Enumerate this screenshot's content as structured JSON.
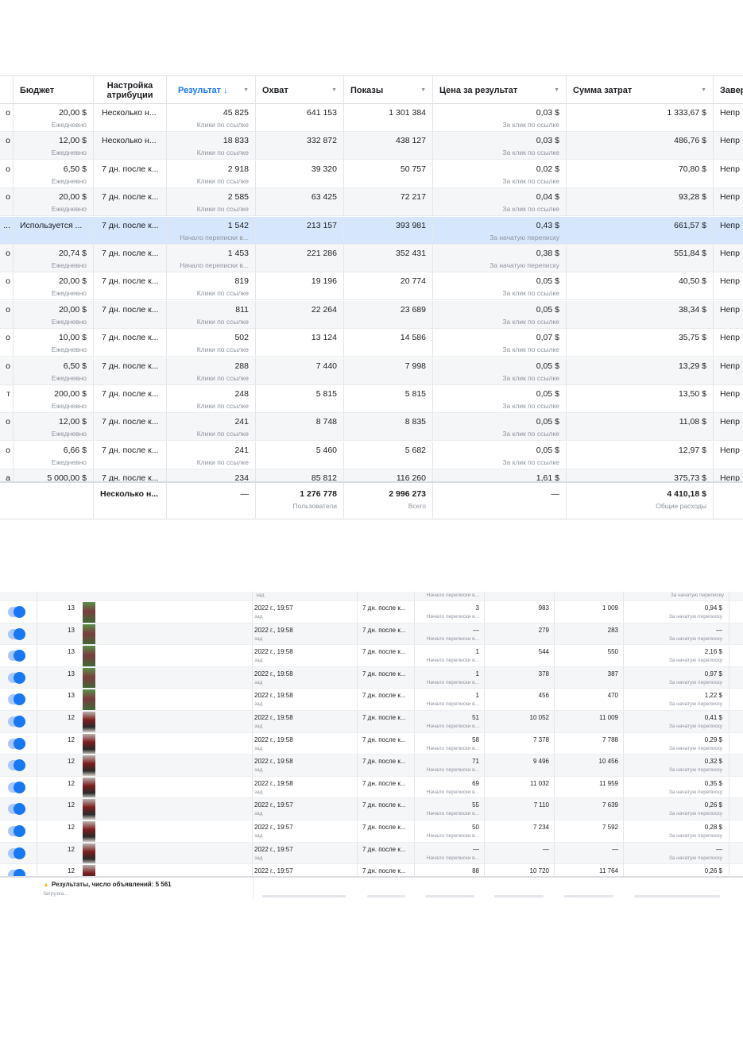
{
  "top_table": {
    "headers": [
      {
        "label": "Бюджет"
      },
      {
        "label": "Настройка атрибуции"
      },
      {
        "label": "Результат ↓"
      },
      {
        "label": "Охват"
      },
      {
        "label": "Показы"
      },
      {
        "label": "Цена за результат"
      },
      {
        "label": "Сумма затрат"
      },
      {
        "label": "Завер"
      }
    ],
    "rows": [
      {
        "c0": "о",
        "budget": "20,00 $",
        "budget_sub": "Ежедневно",
        "attribution": "Несколько н...",
        "result": "45 825",
        "result_sub": "Клики по ссылке",
        "reach": "641 153",
        "impressions": "1 301 384",
        "cpr": "0,03 $",
        "cpr_sub": "За клик по ссылке",
        "spend": "1 333,67 $",
        "end": "Непр"
      },
      {
        "c0": "о",
        "budget": "12,00 $",
        "budget_sub": "Ежедневно",
        "attribution": "Несколько н...",
        "result": "18 833",
        "result_sub": "Клики по ссылке",
        "reach": "332 872",
        "impressions": "438 127",
        "cpr": "0,03 $",
        "cpr_sub": "За клик по ссылке",
        "spend": "486,76 $",
        "end": "Непр"
      },
      {
        "c0": "о",
        "budget": "6,50 $",
        "budget_sub": "Ежедневно",
        "attribution": "7 дн. после к...",
        "result": "2 918",
        "result_sub": "Клики по ссылке",
        "reach": "39 320",
        "impressions": "50 757",
        "cpr": "0,02 $",
        "cpr_sub": "За клик по ссылке",
        "spend": "70,80 $",
        "end": "Непр"
      },
      {
        "c0": "о",
        "budget": "20,00 $",
        "budget_sub": "Ежедневно",
        "attribution": "7 дн. после к...",
        "result": "2 585",
        "result_sub": "Клики по ссылке",
        "reach": "63 425",
        "impressions": "72 217",
        "cpr": "0,04 $",
        "cpr_sub": "За клик по ссылке",
        "spend": "93,28 $",
        "end": "Непр"
      },
      {
        "c0": "...",
        "budget_left": "Используется ...",
        "budget": "",
        "budget_sub": "",
        "attribution": "7 дн. после к...",
        "result": "1 542",
        "result_sub": "Начало переписки в...",
        "reach": "213 157",
        "impressions": "393 981",
        "cpr": "0,43 $",
        "cpr_sub": "За начатую переписку",
        "spend": "661,57 $",
        "end": "Непр"
      },
      {
        "c0": "о",
        "budget": "20,74 $",
        "budget_sub": "Ежедневно",
        "attribution": "7 дн. после к...",
        "result": "1 453",
        "result_sub": "Начало переписки в...",
        "reach": "221 286",
        "impressions": "352 431",
        "cpr": "0,38 $",
        "cpr_sub": "За начатую переписку",
        "spend": "551,84 $",
        "end": "Непр"
      },
      {
        "c0": "о",
        "budget": "20,00 $",
        "budget_sub": "Ежедневно",
        "attribution": "7 дн. после к...",
        "result": "819",
        "result_sub": "Клики по ссылке",
        "reach": "19 196",
        "impressions": "20 774",
        "cpr": "0,05 $",
        "cpr_sub": "За клик по ссылке",
        "spend": "40,50 $",
        "end": "Непр"
      },
      {
        "c0": "о",
        "budget": "20,00 $",
        "budget_sub": "Ежедневно",
        "attribution": "7 дн. после к...",
        "result": "811",
        "result_sub": "Клики по ссылке",
        "reach": "22 264",
        "impressions": "23 689",
        "cpr": "0,05 $",
        "cpr_sub": "За клик по ссылке",
        "spend": "38,34 $",
        "end": "Непр"
      },
      {
        "c0": "о",
        "budget": "10,00 $",
        "budget_sub": "Ежедневно",
        "attribution": "7 дн. после к...",
        "result": "502",
        "result_sub": "Клики по ссылке",
        "reach": "13 124",
        "impressions": "14 586",
        "cpr": "0,07 $",
        "cpr_sub": "За клик по ссылке",
        "spend": "35,75 $",
        "end": "Непр"
      },
      {
        "c0": "о",
        "budget": "6,50 $",
        "budget_sub": "Ежедневно",
        "attribution": "7 дн. после к...",
        "result": "288",
        "result_sub": "Клики по ссылке",
        "reach": "7 440",
        "impressions": "7 998",
        "cpr": "0,05 $",
        "cpr_sub": "За клик по ссылке",
        "spend": "13,29 $",
        "end": "Непр"
      },
      {
        "c0": "т",
        "budget": "200,00 $",
        "budget_sub": "Ежедневно",
        "attribution": "7 дн. после к...",
        "result": "248",
        "result_sub": "Клики по ссылке",
        "reach": "5 815",
        "impressions": "5 815",
        "cpr": "0,05 $",
        "cpr_sub": "За клик по ссылке",
        "spend": "13,50 $",
        "end": "Непр"
      },
      {
        "c0": "о",
        "budget": "12,00 $",
        "budget_sub": "Ежедневно",
        "attribution": "7 дн. после к...",
        "result": "241",
        "result_sub": "Клики по ссылке",
        "reach": "8 748",
        "impressions": "8 835",
        "cpr": "0,05 $",
        "cpr_sub": "За клик по ссылке",
        "spend": "11,08 $",
        "end": "Непр"
      },
      {
        "c0": "о",
        "budget": "6,66 $",
        "budget_sub": "Ежедневно",
        "attribution": "7 дн. после к...",
        "result": "241",
        "result_sub": "Клики по ссылке",
        "reach": "5 460",
        "impressions": "5 682",
        "cpr": "0,05 $",
        "cpr_sub": "За клик по ссылке",
        "spend": "12,97 $",
        "end": "Непр"
      },
      {
        "c0": "а",
        "budget": "5 000,00 $",
        "budget_sub": "",
        "attribution": "7 дн. после к...",
        "result": "234",
        "result_sub": "",
        "reach": "85 812",
        "impressions": "116 260",
        "cpr": "1,61 $",
        "cpr_sub": "",
        "spend": "375,73 $",
        "end": "Непр"
      }
    ],
    "totals": {
      "attribution": "Несколько н...",
      "result": "—",
      "reach": "1 276 778",
      "reach_sub": "Пользователи",
      "impressions": "2 996 273",
      "impressions_sub": "Всего",
      "cpr": "—",
      "spend": "4 410,18 $",
      "spend_sub": "Общие расходы"
    }
  },
  "bottom_table": {
    "top_partial": {
      "date_sub": "зад",
      "result_sub": "Начало переписки в...",
      "cpr_sub": "За начатую переписку"
    },
    "rows": [
      {
        "thumb": "green",
        "num": "13",
        "date": "2022 г., 19:57",
        "date_sub": "зад",
        "attribution": "7 дн. после к...",
        "result": "3",
        "result_sub": "Начало переписки в...",
        "reach": "983",
        "impressions": "1 009",
        "cpr": "0,94 $",
        "cpr_sub": "За начатую переписку"
      },
      {
        "thumb": "green",
        "num": "13",
        "date": "2022 г., 19:58",
        "date_sub": "зад",
        "attribution": "7 дн. после к...",
        "result": "—",
        "result_sub": "Начало переписки в...",
        "reach": "279",
        "impressions": "283",
        "cpr": "—",
        "cpr_sub": "За начатую переписку"
      },
      {
        "thumb": "green",
        "num": "13",
        "date": "2022 г., 19:58",
        "date_sub": "зад",
        "attribution": "7 дн. после к...",
        "result": "1",
        "result_sub": "Начало переписки в...",
        "reach": "544",
        "impressions": "550",
        "cpr": "2,16 $",
        "cpr_sub": "За начатую переписку"
      },
      {
        "thumb": "green",
        "num": "13",
        "date": "2022 г., 19:58",
        "date_sub": "зад",
        "attribution": "7 дн. после к...",
        "result": "1",
        "result_sub": "Начало переписки в...",
        "reach": "378",
        "impressions": "387",
        "cpr": "0,97 $",
        "cpr_sub": "За начатую переписку"
      },
      {
        "thumb": "green",
        "num": "13",
        "date": "2022 г., 19:58",
        "date_sub": "зад",
        "attribution": "7 дн. после к...",
        "result": "1",
        "result_sub": "Начало переписки в...",
        "reach": "456",
        "impressions": "470",
        "cpr": "1,22 $",
        "cpr_sub": "За начатую переписку"
      },
      {
        "thumb": "red",
        "num": "12",
        "date": "2022 г., 19:58",
        "date_sub": "зад",
        "attribution": "7 дн. после к...",
        "result": "51",
        "result_sub": "Начало переписки в...",
        "reach": "10 052",
        "impressions": "11 009",
        "cpr": "0,41 $",
        "cpr_sub": "За начатую переписку"
      },
      {
        "thumb": "red",
        "num": "12",
        "date": "2022 г., 19:58",
        "date_sub": "зад",
        "attribution": "7 дн. после к...",
        "result": "58",
        "result_sub": "Начало переписки в...",
        "reach": "7 378",
        "impressions": "7 788",
        "cpr": "0,29 $",
        "cpr_sub": "За начатую переписку"
      },
      {
        "thumb": "red",
        "num": "12",
        "date": "2022 г., 19:58",
        "date_sub": "зад",
        "attribution": "7 дн. после к...",
        "result": "71",
        "result_sub": "Начало переписки в...",
        "reach": "9 496",
        "impressions": "10 456",
        "cpr": "0,32 $",
        "cpr_sub": "За начатую переписку"
      },
      {
        "thumb": "red",
        "num": "12",
        "date": "2022 г., 19:58",
        "date_sub": "зад",
        "attribution": "7 дн. после к...",
        "result": "69",
        "result_sub": "Начало переписки в...",
        "reach": "11 032",
        "impressions": "11 959",
        "cpr": "0,35 $",
        "cpr_sub": "За начатую переписку"
      },
      {
        "thumb": "red",
        "num": "12",
        "date": "2022 г., 19:57",
        "date_sub": "зад",
        "attribution": "7 дн. после к...",
        "result": "55",
        "result_sub": "Начало переписки в...",
        "reach": "7 110",
        "impressions": "7 639",
        "cpr": "0,26 $",
        "cpr_sub": "За начатую переписку"
      },
      {
        "thumb": "red",
        "num": "12",
        "date": "2022 г., 19:57",
        "date_sub": "зад",
        "attribution": "7 дн. после к...",
        "result": "50",
        "result_sub": "Начало переписки в...",
        "reach": "7 234",
        "impressions": "7 592",
        "cpr": "0,28 $",
        "cpr_sub": "За начатую переписку"
      },
      {
        "thumb": "red",
        "num": "12",
        "date": "2022 г., 19:57",
        "date_sub": "зад",
        "attribution": "7 дн. после к...",
        "result": "—",
        "result_sub": "Начало переписки в...",
        "reach": "—",
        "impressions": "—",
        "cpr": "—",
        "cpr_sub": "За начатую переписку"
      },
      {
        "thumb": "red",
        "num": "12",
        "date": "2022 г., 19:57",
        "date_sub": "",
        "attribution": "7 дн. после к...",
        "result": "88",
        "result_sub": "",
        "reach": "10 720",
        "impressions": "11 764",
        "cpr": "0,26 $",
        "cpr_sub": ""
      }
    ],
    "footer": {
      "warning": "Результаты, число объявлений: 5 561",
      "loading": "Загрузка..."
    }
  }
}
